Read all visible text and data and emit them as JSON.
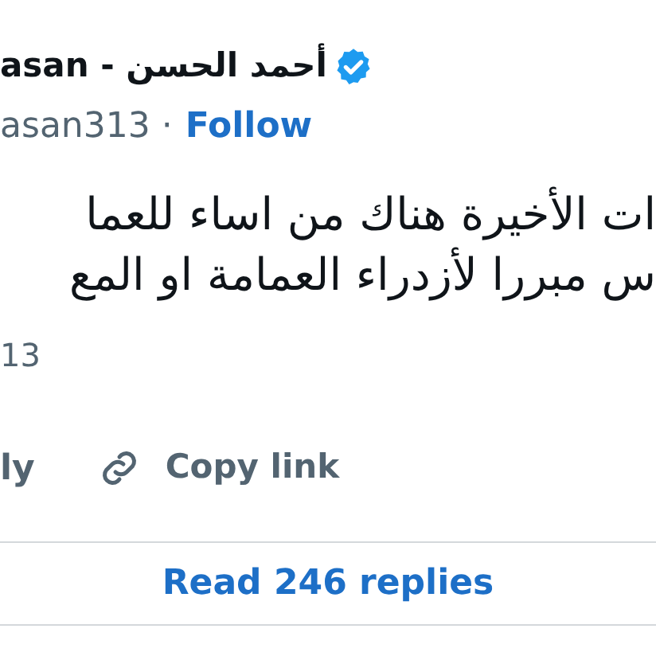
{
  "author": {
    "name": "asan - أحمد الحسن",
    "verified": true,
    "handle": "asan313 ·",
    "follow": "Follow"
  },
  "tweet": {
    "lines": [
      "ات الأخيرة هناك من اساء للعما",
      "س مبررا لأزدراء العمامة او المع"
    ],
    "date": "13"
  },
  "reply": "ly",
  "copy_link": "Copy link",
  "replies_button": "Read 246 replies"
}
